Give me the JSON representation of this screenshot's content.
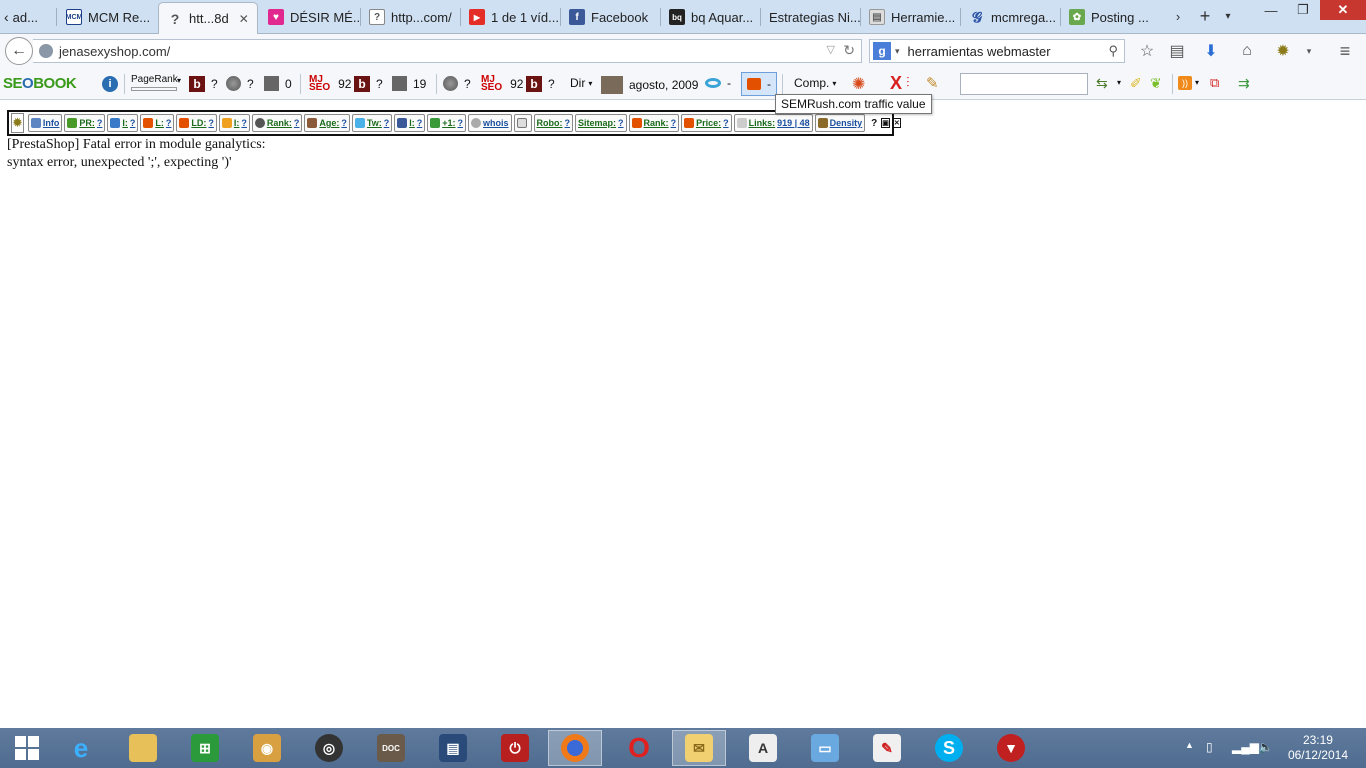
{
  "tabs": [
    {
      "label": "ad...",
      "icon": "tab-scroll-left-icon",
      "active": false
    },
    {
      "label": "MCM Re...",
      "icon": "mcm-favicon-icon",
      "active": false
    },
    {
      "label": "htt...8d",
      "icon": "unknown-page-icon",
      "active": true
    },
    {
      "label": "DÉSIR MÉ...",
      "icon": "heart-favicon-icon",
      "active": false
    },
    {
      "label": "http...com/",
      "icon": "unknown-page-icon",
      "active": false
    },
    {
      "label": "1 de 1 víd...",
      "icon": "youtube-favicon-icon",
      "active": false
    },
    {
      "label": "Facebook",
      "icon": "facebook-favicon-icon",
      "active": false
    },
    {
      "label": "bq Aquar...",
      "icon": "bq-favicon-icon",
      "active": false
    },
    {
      "label": "Estrategias Ni...",
      "icon": "",
      "active": false
    },
    {
      "label": "Herramie...",
      "icon": "tools-favicon-icon",
      "active": false
    },
    {
      "label": "mcmrega...",
      "icon": "blog-favicon-icon",
      "active": false
    },
    {
      "label": "Posting ...",
      "icon": "posting-favicon-icon",
      "active": false
    }
  ],
  "address": {
    "url": "jenasexyshop.com/"
  },
  "search": {
    "engine_icon": "google-icon",
    "value": "herramientas webmaster"
  },
  "seo_toolbar": {
    "logo_a": "SE",
    "logo_o": "O",
    "logo_b": "BOOK",
    "pagerank_label": "PageRank",
    "b1": "?",
    "g1": "?",
    "cal1": "0",
    "mj1": "92",
    "b2": "?",
    "cal2": "19",
    "g2": "?",
    "mj2": "92",
    "b3": "?",
    "dir_label": "Dir",
    "date": "agosto, 2009",
    "dash1": "-",
    "dash2": "-",
    "comp_label": "Comp."
  },
  "tooltip": "SEMRush.com traffic value",
  "mini_bar": [
    {
      "label": "Info",
      "value": ""
    },
    {
      "label": "PR:",
      "value": "?"
    },
    {
      "label": "I:",
      "value": "?"
    },
    {
      "label": "L:",
      "value": "?"
    },
    {
      "label": "LD:",
      "value": "?"
    },
    {
      "label": "I:",
      "value": "?"
    },
    {
      "label": "Rank:",
      "value": "?"
    },
    {
      "label": "Age:",
      "value": "?"
    },
    {
      "label": "Tw:",
      "value": "?"
    },
    {
      "label": "l:",
      "value": "?"
    },
    {
      "label": "+1:",
      "value": "?"
    },
    {
      "label": "whois",
      "value": ""
    },
    {
      "label": "",
      "value": ""
    },
    {
      "label": "Robo:",
      "value": "?"
    },
    {
      "label": "Sitemap:",
      "value": "?"
    },
    {
      "label": "Rank:",
      "value": "?"
    },
    {
      "label": "Price:",
      "value": "?"
    },
    {
      "label": "Links:",
      "value": "919 | 48"
    },
    {
      "label": "Density",
      "value": ""
    }
  ],
  "mini_bar_help": "?",
  "error_line1": "[PrestaShop] Fatal error in module ganalytics:",
  "error_line2": "syntax error, unexpected ';', expecting ')'",
  "clock": {
    "time": "23:19",
    "date": "06/12/2014"
  }
}
